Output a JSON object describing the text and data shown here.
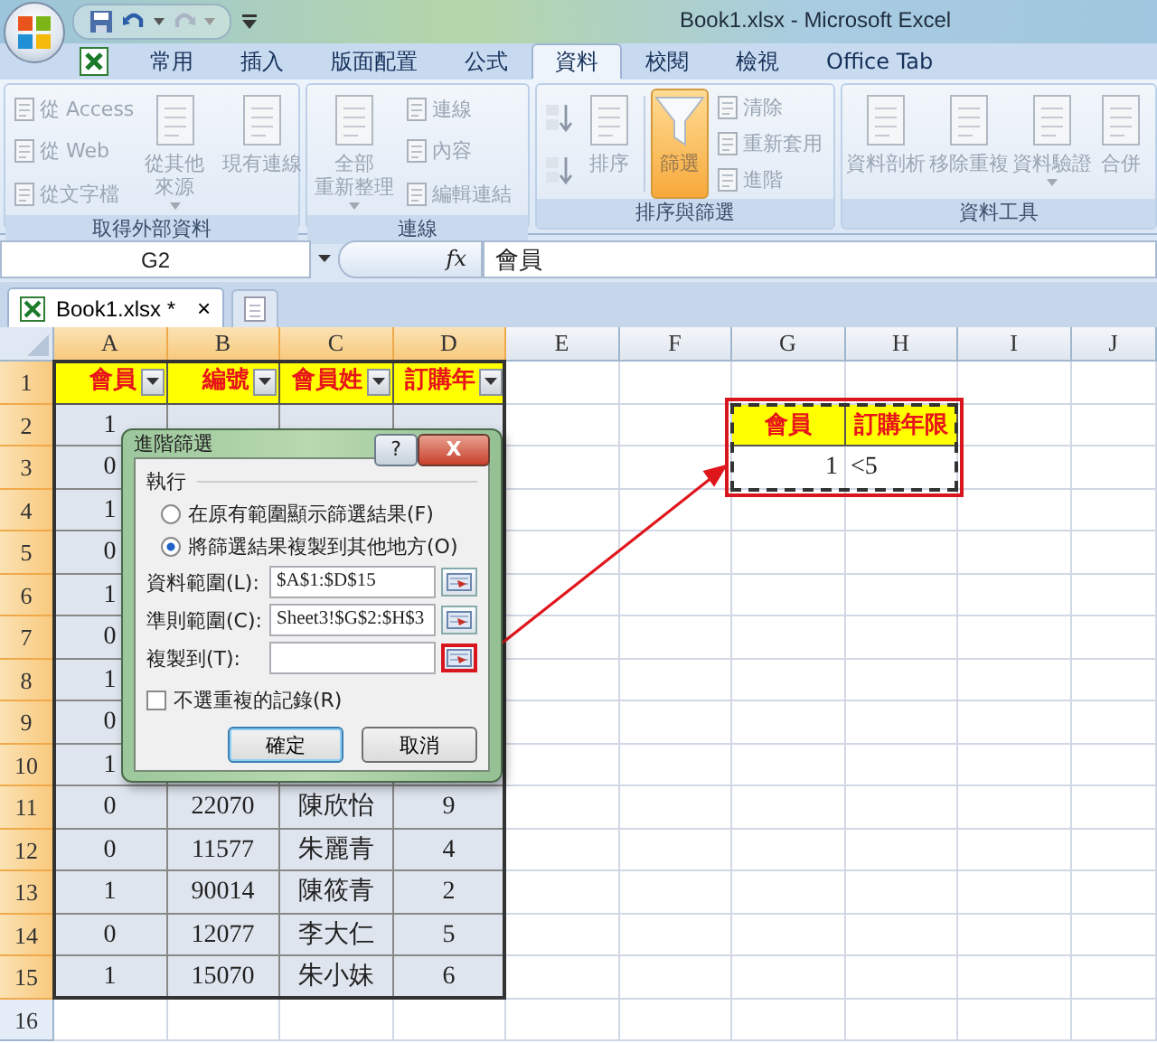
{
  "window": {
    "title": "Book1.xlsx - Microsoft Excel"
  },
  "ribbon_tabs": [
    {
      "label": "常用",
      "selected": false
    },
    {
      "label": "插入",
      "selected": false
    },
    {
      "label": "版面配置",
      "selected": false
    },
    {
      "label": "公式",
      "selected": false
    },
    {
      "label": "資料",
      "selected": true
    },
    {
      "label": "校閱",
      "selected": false
    },
    {
      "label": "檢視",
      "selected": false
    },
    {
      "label": "Office Tab",
      "selected": false
    }
  ],
  "ribbon_groups": [
    {
      "label": "取得外部資料",
      "items": [
        {
          "kind": "small_column",
          "buttons": [
            {
              "label": "從 Access",
              "disabled": true
            },
            {
              "label": "從 Web",
              "disabled": true
            },
            {
              "label": "從文字檔",
              "disabled": true
            }
          ]
        },
        {
          "kind": "large",
          "lines": [
            "從其他",
            "來源"
          ],
          "caret": true,
          "disabled": true,
          "pressed": false
        },
        {
          "kind": "separator"
        },
        {
          "kind": "large",
          "lines": [
            "現有連線"
          ],
          "caret": false,
          "disabled": true,
          "pressed": false
        }
      ]
    },
    {
      "label": "連線",
      "items": [
        {
          "kind": "large",
          "lines": [
            "全部",
            "重新整理"
          ],
          "caret": true,
          "disabled": true,
          "pressed": false
        },
        {
          "kind": "small_column",
          "buttons": [
            {
              "label": "連線",
              "disabled": true
            },
            {
              "label": "內容",
              "disabled": true
            },
            {
              "label": "編輯連結",
              "disabled": true
            }
          ]
        }
      ]
    },
    {
      "label": "排序與篩選",
      "items": [
        {
          "kind": "sort_pair"
        },
        {
          "kind": "large",
          "lines": [
            "排序"
          ],
          "caret": false,
          "disabled": true,
          "pressed": false
        },
        {
          "kind": "separator"
        },
        {
          "kind": "filter",
          "lines": [
            "篩選"
          ],
          "caret": false,
          "disabled": true,
          "pressed": true
        },
        {
          "kind": "small_column",
          "buttons": [
            {
              "label": "清除",
              "disabled": true
            },
            {
              "label": "重新套用",
              "disabled": true
            },
            {
              "label": "進階",
              "disabled": true
            }
          ]
        }
      ]
    },
    {
      "label": "資料工具",
      "items": [
        {
          "kind": "large",
          "lines": [
            "資料剖析"
          ],
          "caret": false,
          "disabled": true,
          "pressed": false
        },
        {
          "kind": "large",
          "lines": [
            "移除重複"
          ],
          "caret": false,
          "disabled": true,
          "pressed": false
        },
        {
          "kind": "large",
          "lines": [
            "資料驗證"
          ],
          "caret": true,
          "disabled": true,
          "pressed": false
        },
        {
          "kind": "large",
          "lines": [
            "合併"
          ],
          "caret": false,
          "disabled": true,
          "pressed": false
        }
      ]
    }
  ],
  "formula_bar": {
    "name_box": "G2",
    "function_label": "fx",
    "formula": "會員"
  },
  "workbook_tabs": [
    {
      "label": "Book1.xlsx *",
      "close": "×",
      "selected": true
    }
  ],
  "columns": [
    {
      "label": "A",
      "selected": true
    },
    {
      "label": "B",
      "selected": true
    },
    {
      "label": "C",
      "selected": true
    },
    {
      "label": "D",
      "selected": true
    },
    {
      "label": "E",
      "selected": false
    },
    {
      "label": "F",
      "selected": false
    },
    {
      "label": "G",
      "selected": false
    },
    {
      "label": "H",
      "selected": false
    },
    {
      "label": "I",
      "selected": false
    },
    {
      "label": "J",
      "selected": false
    }
  ],
  "rows": [
    {
      "number": "1",
      "selected": true,
      "cells": [
        {
          "text": "會員",
          "kind": "filter_header"
        },
        {
          "text": "編號",
          "kind": "filter_header"
        },
        {
          "text": "會員姓",
          "kind": "filter_header"
        },
        {
          "text": "訂購年",
          "kind": "filter_header"
        },
        null,
        null,
        null,
        null,
        null,
        null
      ]
    },
    {
      "number": "2",
      "selected": true,
      "cells": [
        {
          "text": "1",
          "kind": "value"
        },
        null,
        null,
        null,
        null,
        null,
        {
          "text": "會員",
          "kind": "criteria_header"
        },
        {
          "text": "訂購年限",
          "kind": "criteria_header"
        },
        null,
        null
      ]
    },
    {
      "number": "3",
      "selected": true,
      "cells": [
        {
          "text": "0",
          "kind": "value"
        },
        null,
        null,
        null,
        null,
        null,
        {
          "text": "1",
          "kind": "number"
        },
        {
          "text": "<5",
          "kind": "text"
        },
        null,
        null
      ]
    },
    {
      "number": "4",
      "selected": true,
      "cells": [
        {
          "text": "1",
          "kind": "value"
        },
        null,
        null,
        null,
        null,
        null,
        null,
        null,
        null,
        null
      ]
    },
    {
      "number": "5",
      "selected": true,
      "cells": [
        {
          "text": "0",
          "kind": "value"
        },
        null,
        null,
        null,
        null,
        null,
        null,
        null,
        null,
        null
      ]
    },
    {
      "number": "6",
      "selected": true,
      "cells": [
        {
          "text": "1",
          "kind": "value"
        },
        null,
        null,
        null,
        null,
        null,
        null,
        null,
        null,
        null
      ]
    },
    {
      "number": "7",
      "selected": true,
      "cells": [
        {
          "text": "0",
          "kind": "value"
        },
        null,
        null,
        null,
        null,
        null,
        null,
        null,
        null,
        null
      ]
    },
    {
      "number": "8",
      "selected": true,
      "cells": [
        {
          "text": "1",
          "kind": "value"
        },
        null,
        null,
        null,
        null,
        null,
        null,
        null,
        null,
        null
      ]
    },
    {
      "number": "9",
      "selected": true,
      "cells": [
        {
          "text": "0",
          "kind": "value"
        },
        null,
        null,
        null,
        null,
        null,
        null,
        null,
        null,
        null
      ]
    },
    {
      "number": "10",
      "selected": true,
      "cells": [
        {
          "text": "1",
          "kind": "value"
        },
        null,
        null,
        null,
        null,
        null,
        null,
        null,
        null,
        null
      ]
    },
    {
      "number": "11",
      "selected": true,
      "cells": [
        {
          "text": "0",
          "kind": "value"
        },
        {
          "text": "22070",
          "kind": "value"
        },
        {
          "text": "陳欣怡",
          "kind": "value"
        },
        {
          "text": "9",
          "kind": "value"
        },
        null,
        null,
        null,
        null,
        null,
        null
      ]
    },
    {
      "number": "12",
      "selected": true,
      "cells": [
        {
          "text": "0",
          "kind": "value"
        },
        {
          "text": "11577",
          "kind": "value"
        },
        {
          "text": "朱麗青",
          "kind": "value"
        },
        {
          "text": "4",
          "kind": "value"
        },
        null,
        null,
        null,
        null,
        null,
        null
      ]
    },
    {
      "number": "13",
      "selected": true,
      "cells": [
        {
          "text": "1",
          "kind": "value"
        },
        {
          "text": "90014",
          "kind": "value"
        },
        {
          "text": "陳筱青",
          "kind": "value"
        },
        {
          "text": "2",
          "kind": "value"
        },
        null,
        null,
        null,
        null,
        null,
        null
      ]
    },
    {
      "number": "14",
      "selected": true,
      "cells": [
        {
          "text": "0",
          "kind": "value"
        },
        {
          "text": "12077",
          "kind": "value"
        },
        {
          "text": "李大仁",
          "kind": "value"
        },
        {
          "text": "5",
          "kind": "value"
        },
        null,
        null,
        null,
        null,
        null,
        null
      ]
    },
    {
      "number": "15",
      "selected": true,
      "cells": [
        {
          "text": "1",
          "kind": "value"
        },
        {
          "text": "15070",
          "kind": "value"
        },
        {
          "text": "朱小妹",
          "kind": "value"
        },
        {
          "text": "6",
          "kind": "value"
        },
        null,
        null,
        null,
        null,
        null,
        null
      ]
    },
    {
      "number": "16",
      "selected": false,
      "cells": [
        null,
        null,
        null,
        null,
        null,
        null,
        null,
        null,
        null,
        null
      ]
    }
  ],
  "callout": {
    "frame": true,
    "marquee": true,
    "arrow": true
  },
  "dialog": {
    "title": "進階篩選",
    "help": "?",
    "close": "X",
    "section": "執行",
    "options": [
      {
        "label": "在原有範圍顯示篩選結果(F)",
        "selected": false
      },
      {
        "label": "將篩選結果複製到其他地方(O)",
        "selected": true
      }
    ],
    "fields": [
      {
        "label": "資料範圍(L):",
        "value": "$A$1:$D$15",
        "highlighted": false
      },
      {
        "label": "準則範圍(C):",
        "value": "Sheet3!$G$2:$H$3",
        "highlighted": false
      },
      {
        "label": "複製到(T):",
        "highlighted": true
      }
    ],
    "checkbox": {
      "label": "不選重複的記錄(R)",
      "checked": false
    },
    "buttons": [
      {
        "label": "確定",
        "kind": "default"
      },
      {
        "label": "取消",
        "kind": "normal"
      }
    ]
  }
}
